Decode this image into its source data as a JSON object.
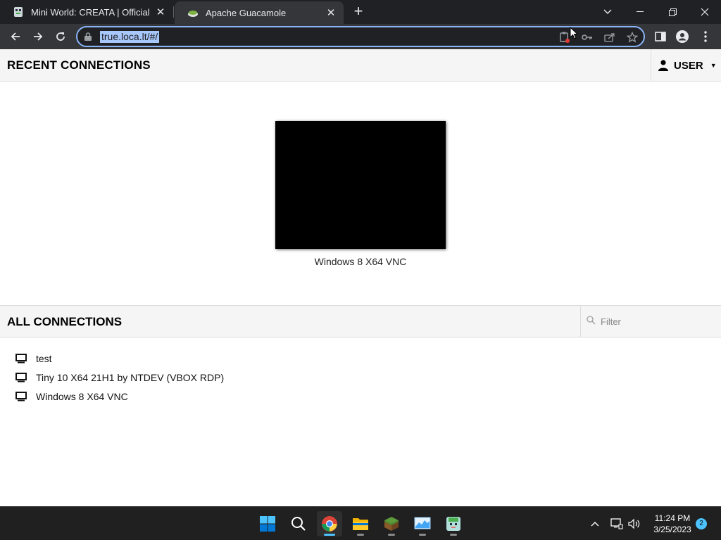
{
  "browser": {
    "tabs": [
      {
        "title": "Mini World: CREATA | Official",
        "active": false
      },
      {
        "title": "Apache Guacamole",
        "active": true
      }
    ],
    "url": "true.loca.lt/#/"
  },
  "app": {
    "recent_heading": "RECENT CONNECTIONS",
    "user_menu_label": "USER",
    "recent_connections": [
      {
        "name": "Windows 8 X64 VNC"
      }
    ],
    "all_heading": "ALL CONNECTIONS",
    "filter_placeholder": "Filter",
    "connections": [
      {
        "name": "test"
      },
      {
        "name": "Tiny 10 X64 21H1 by NTDEV (VBOX RDP)"
      },
      {
        "name": "Windows 8 X64 VNC"
      }
    ]
  },
  "taskbar": {
    "time": "11:24 PM",
    "date": "3/25/2023",
    "notification_count": "2"
  },
  "colors": {
    "accent_url_highlight": "#a8c7fa",
    "omnibox_focus_ring": "#8ab4f8",
    "taskbar_accent": "#4cc2ff"
  }
}
